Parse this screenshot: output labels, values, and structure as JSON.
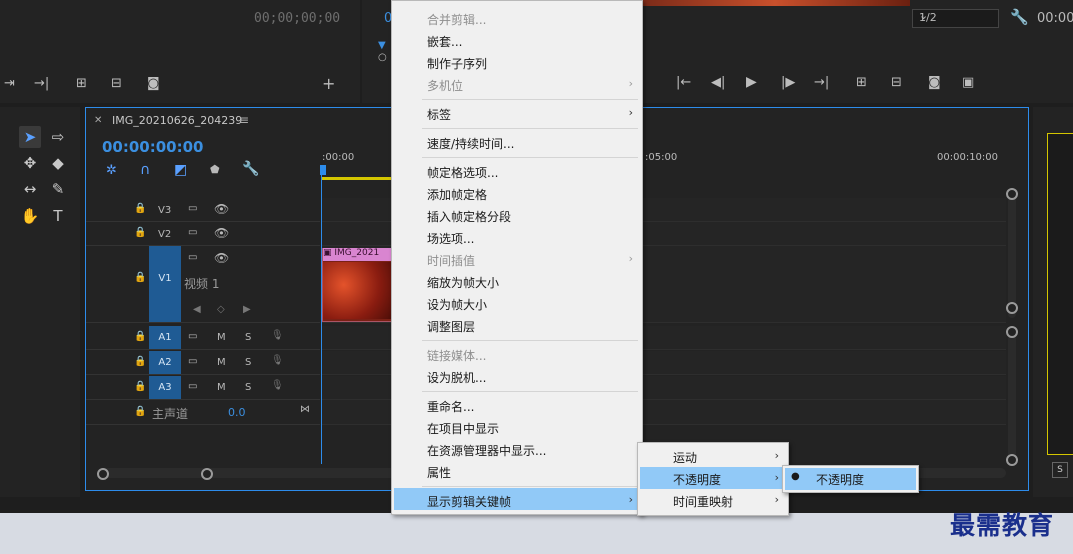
{
  "source_monitor": {
    "timecode": "00;00;00;00"
  },
  "program_monitor": {
    "timecode_left": "0",
    "resolution": "1/2",
    "timecode_right": "00:00"
  },
  "sequence": {
    "name": "IMG_20210626_204239",
    "timecode": "00:00:00:00"
  },
  "ruler": {
    "t0": ":00:00",
    "t1": ":05:00",
    "t2": "00:00:10:00"
  },
  "video_tracks": [
    {
      "label": "V3"
    },
    {
      "label": "V2"
    },
    {
      "label": "V1",
      "name": "视频 1"
    }
  ],
  "audio_tracks": [
    {
      "label": "A1",
      "m": "M",
      "s": "S"
    },
    {
      "label": "A2",
      "m": "M",
      "s": "S"
    },
    {
      "label": "A3",
      "m": "M",
      "s": "S"
    }
  ],
  "master": {
    "label": "主声道",
    "value": "0.0"
  },
  "clip": {
    "label": "IMG_2021"
  },
  "context_menu": {
    "items": [
      {
        "label": "合并剪辑...",
        "disabled": true
      },
      {
        "label": "嵌套..."
      },
      {
        "label": "制作子序列"
      },
      {
        "label": "多机位",
        "disabled": true
      },
      {
        "label": "标签"
      },
      {
        "label": "速度/持续时间..."
      },
      {
        "label": "帧定格选项..."
      },
      {
        "label": "添加帧定格"
      },
      {
        "label": "插入帧定格分段"
      },
      {
        "label": "场选项..."
      },
      {
        "label": "时间插值",
        "disabled": true
      },
      {
        "label": "缩放为帧大小"
      },
      {
        "label": "设为帧大小"
      },
      {
        "label": "调整图层"
      },
      {
        "label": "链接媒体...",
        "disabled": true
      },
      {
        "label": "设为脱机..."
      },
      {
        "label": "重命名..."
      },
      {
        "label": "在项目中显示"
      },
      {
        "label": "在资源管理器中显示..."
      },
      {
        "label": "属性"
      },
      {
        "label": "显示剪辑关键帧"
      }
    ]
  },
  "submenu": {
    "items": [
      {
        "label": "运动"
      },
      {
        "label": "不透明度"
      },
      {
        "label": "时间重映射"
      }
    ]
  },
  "submenu2": {
    "items": [
      {
        "label": "不透明度"
      }
    ]
  },
  "watermark": {
    "text": "最需教育"
  },
  "right_panel": {
    "s_label": "S"
  },
  "icons": {
    "arrow": "›",
    "bullet": "●"
  }
}
